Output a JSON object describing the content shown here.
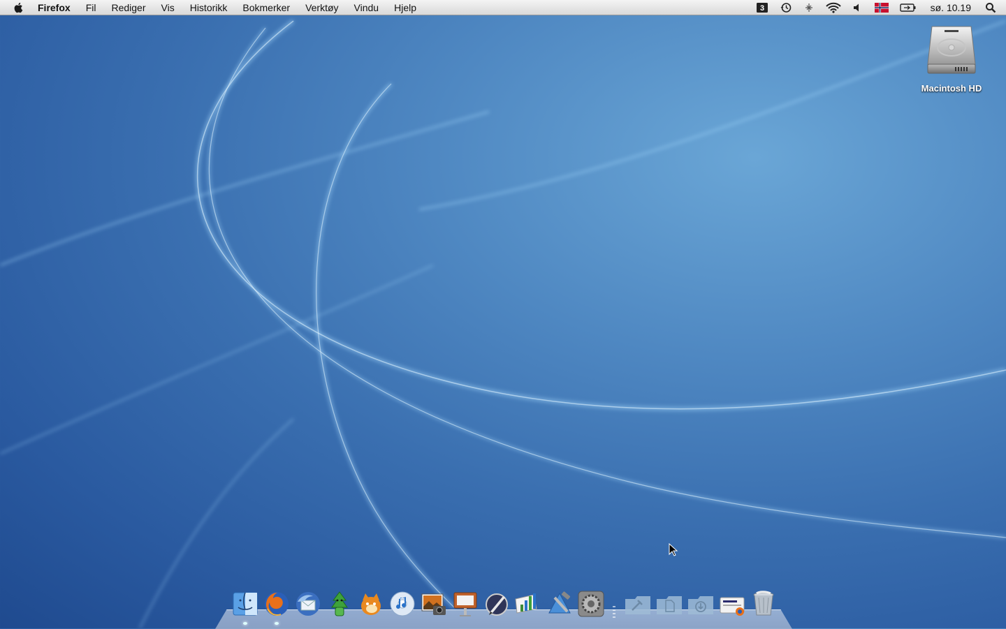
{
  "menubar": {
    "app_name": "Firefox",
    "menus": [
      "Fil",
      "Rediger",
      "Vis",
      "Historikk",
      "Bokmerker",
      "Verktøy",
      "Vindu",
      "Hjelp"
    ],
    "status_icons": [
      "spaces-icon",
      "time-machine-icon",
      "bluetooth-icon",
      "wifi-icon",
      "volume-icon",
      "flag-icon",
      "battery-icon"
    ],
    "clock": "sø. 10.19",
    "search_icon": "spotlight-icon"
  },
  "desktop": {
    "icons": [
      {
        "label": "Macintosh HD",
        "icon": "hard-drive-icon"
      }
    ]
  },
  "dock": {
    "apps": [
      "finder",
      "firefox",
      "thunderbird",
      "adium",
      "growl",
      "itunes",
      "iphoto",
      "keynote",
      "script-editor",
      "numbers",
      "xcode",
      "system-preferences"
    ],
    "stacks": [
      "developer-folder",
      "documents-folder",
      "downloads-folder",
      "firefox-download",
      "trash"
    ],
    "running": [
      "finder",
      "firefox"
    ]
  },
  "colors": {
    "desktop": "#3a6fb0",
    "menubar": "#e6e6e6"
  }
}
